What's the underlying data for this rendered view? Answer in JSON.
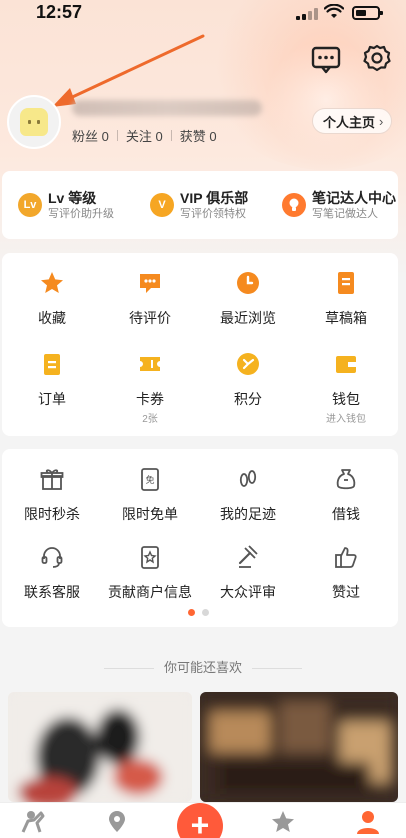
{
  "status": {
    "time": "12:57"
  },
  "user": {
    "stats": [
      {
        "label": "粉丝",
        "value": "0"
      },
      {
        "label": "关注",
        "value": "0"
      },
      {
        "label": "获赞",
        "value": "0"
      }
    ],
    "profile_button": "个人主页",
    "profile_chevron": "›"
  },
  "levels": [
    {
      "icon": "lv-badge-icon",
      "badge": "Lv",
      "title": "Lv 等级",
      "subtitle": "写评价助升级",
      "color": "#f2a72b"
    },
    {
      "icon": "vip-badge-icon",
      "badge": "V",
      "title": "VIP 俱乐部",
      "subtitle": "写评价领特权",
      "color": "#f6a623"
    },
    {
      "icon": "bulb-icon",
      "badge": "",
      "title": "笔记达人中心",
      "subtitle": "写笔记做达人",
      "color": "#ff7a2f"
    }
  ],
  "grid1": [
    {
      "icon": "star-icon",
      "label": "收藏",
      "sub": ""
    },
    {
      "icon": "comment-pending-icon",
      "label": "待评价",
      "sub": ""
    },
    {
      "icon": "clock-icon",
      "label": "最近浏览",
      "sub": ""
    },
    {
      "icon": "draft-box-icon",
      "label": "草稿箱",
      "sub": ""
    },
    {
      "icon": "order-icon",
      "label": "订单",
      "sub": ""
    },
    {
      "icon": "coupon-icon",
      "label": "卡券",
      "sub": "2张"
    },
    {
      "icon": "points-icon",
      "label": "积分",
      "sub": ""
    },
    {
      "icon": "wallet-icon",
      "label": "钱包",
      "sub": "进入钱包"
    }
  ],
  "grid2": [
    {
      "icon": "gift-icon",
      "label": "限时秒杀"
    },
    {
      "icon": "free-ticket-icon",
      "label": "限时免单"
    },
    {
      "icon": "footprint-icon",
      "label": "我的足迹"
    },
    {
      "icon": "money-bag-icon",
      "label": "借钱"
    },
    {
      "icon": "headset-icon",
      "label": "联系客服"
    },
    {
      "icon": "merchant-info-icon",
      "label": "贡献商户信息"
    },
    {
      "icon": "gavel-icon",
      "label": "大众评审"
    },
    {
      "icon": "thumbs-up-icon",
      "label": "赞过"
    }
  ],
  "carousel": {
    "active_index": 0,
    "count": 2,
    "active_color": "#ff6633",
    "inactive_color": "#d8d8d8"
  },
  "recommend_title": "你可能还喜欢",
  "tabbar": {
    "tabs": [
      "home-icon",
      "map-pin-icon",
      "add-icon",
      "star-tab-icon",
      "profile-icon"
    ],
    "add_label": "+"
  },
  "colors": {
    "accent": "#ff6633",
    "orange_icon": "#f58a1f",
    "gray_icon": "#555555"
  }
}
